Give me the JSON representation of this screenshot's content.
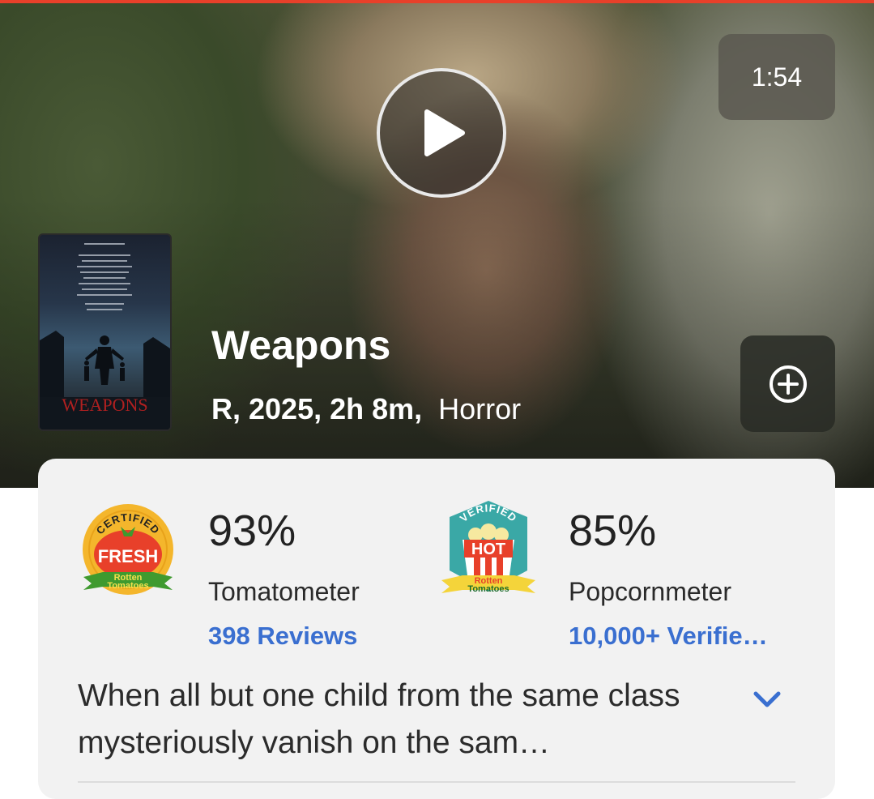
{
  "video": {
    "duration": "1:54"
  },
  "poster": {
    "title_text": "WEAPONS"
  },
  "movie": {
    "title": "Weapons",
    "meta": "R, 2025, 2h 8m,",
    "genre": "Horror"
  },
  "scores": {
    "tomatometer": {
      "value": "93%",
      "label": "Tomatometer",
      "link": "398 Reviews",
      "badge_top": "CERTIFIED",
      "badge_main": "FRESH",
      "badge_brand_1": "Rotten",
      "badge_brand_2": "Tomatoes"
    },
    "popcornmeter": {
      "value": "85%",
      "label": "Popcornmeter",
      "link": "10,000+ Verifie…",
      "badge_top": "VERIFIED",
      "badge_main": "HOT",
      "badge_brand_1": "Rotten",
      "badge_brand_2": "Tomatoes"
    }
  },
  "synopsis": {
    "text": "When all but one child from the same class mysteriously vanish on the sam…"
  },
  "icons": {
    "play": "play-icon",
    "add": "plus-circle-icon",
    "expand": "chevron-down-icon"
  },
  "colors": {
    "accent_bar": "#e8402a",
    "link": "#3a6fd0",
    "fresh_red": "#e8402a",
    "badge_gold": "#f4b62c",
    "badge_teal": "#3aa8a6",
    "badge_green": "#3f9a2f"
  }
}
